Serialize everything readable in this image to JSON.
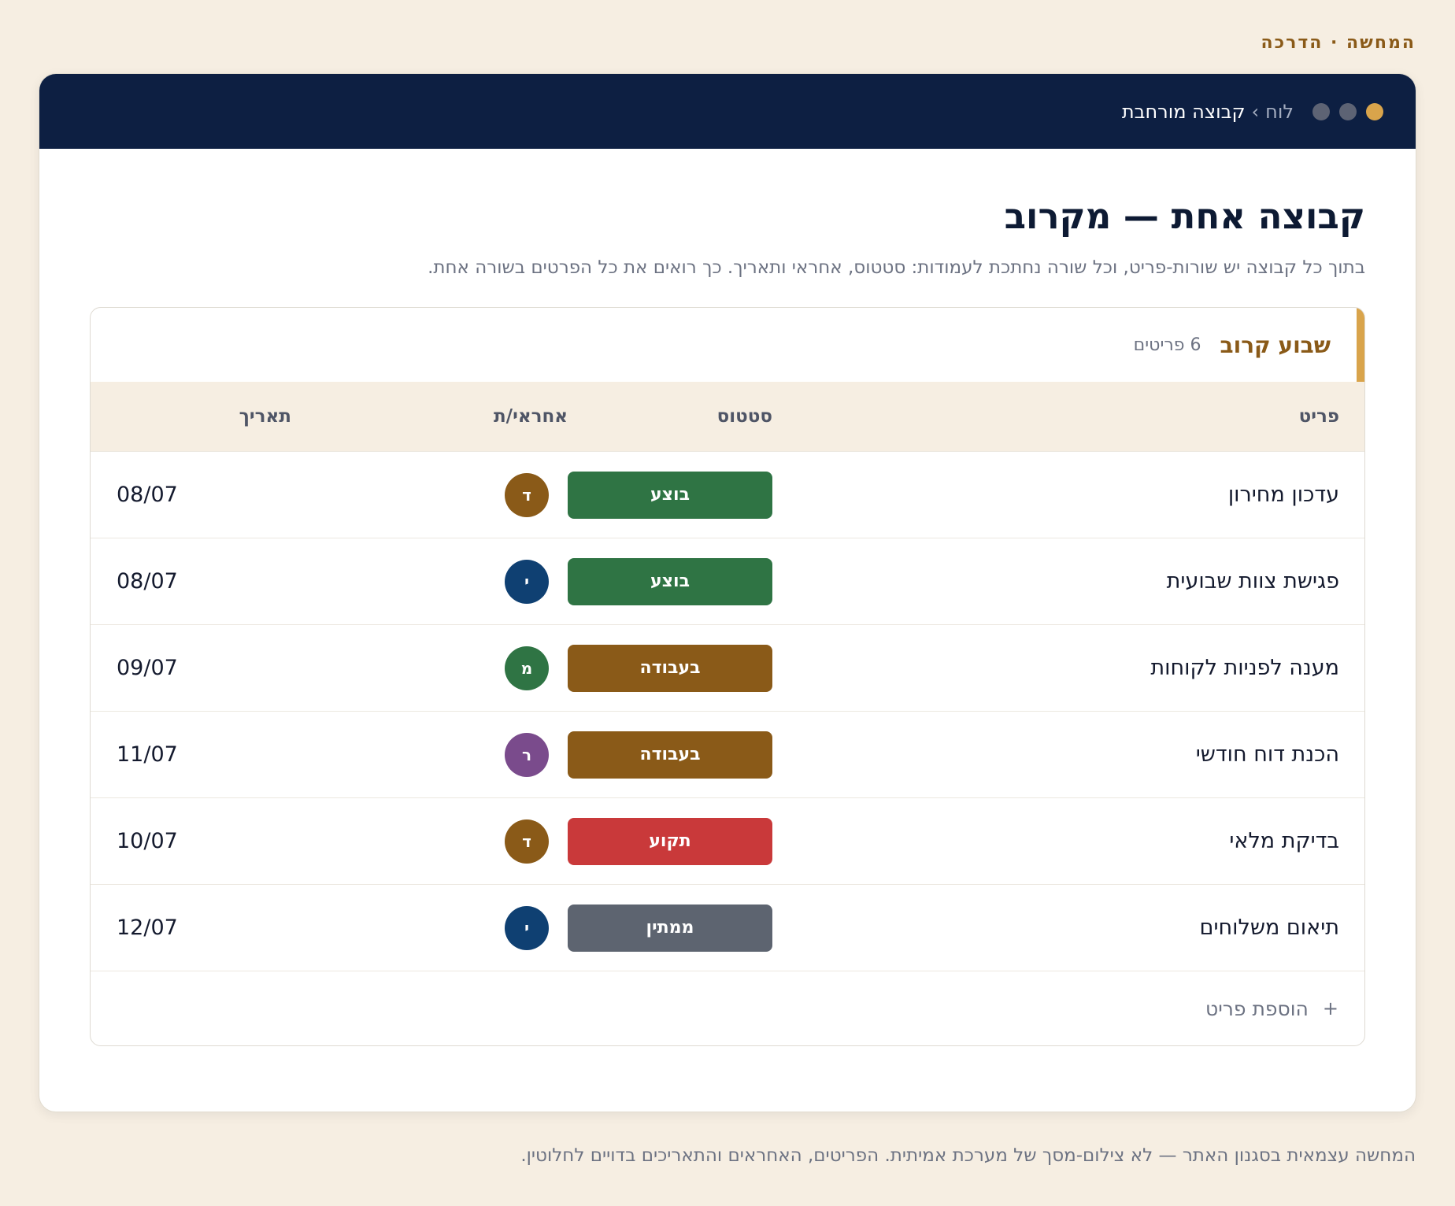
{
  "eyebrow": "המחשה · הדרכה",
  "window": {
    "breadcrumb": {
      "root": "לוח",
      "separator": "›",
      "current": "קבוצה מורחבת"
    }
  },
  "page": {
    "title": "קבוצה אחת — מקרוב",
    "description": "בתוך כל קבוצה יש שורות-פריט, וכל שורה נחתכת לעמודות: סטטוס, אחראי ותאריך. כך רואים את כל הפרטים בשורה אחת."
  },
  "group": {
    "name": "שבוע קרוב",
    "count": "6 פריטים",
    "accent_color": "#d9a44b",
    "columns": {
      "item": "פריט",
      "status": "סטטוס",
      "owner": "אחראי/ת",
      "date": "תאריך"
    },
    "rows": [
      {
        "item": "עדכון מחירון",
        "status": "בוצע",
        "status_color": "#2f7444",
        "owner": "ד",
        "owner_color": "#8a5a18",
        "date": "08/07"
      },
      {
        "item": "פגישת צוות שבועית",
        "status": "בוצע",
        "status_color": "#2f7444",
        "owner": "י",
        "owner_color": "#0f4072",
        "date": "08/07"
      },
      {
        "item": "מענה לפניות לקוחות",
        "status": "בעבודה",
        "status_color": "#8a5a18",
        "owner": "מ",
        "owner_color": "#2f7444",
        "date": "09/07"
      },
      {
        "item": "הכנת דוח חודשי",
        "status": "בעבודה",
        "status_color": "#8a5a18",
        "owner": "ר",
        "owner_color": "#7a4b8c",
        "date": "11/07"
      },
      {
        "item": "בדיקת מלאי",
        "status": "תקוע",
        "status_color": "#c9393a",
        "owner": "ד",
        "owner_color": "#8a5a18",
        "date": "10/07"
      },
      {
        "item": "תיאום משלוחים",
        "status": "ממתין",
        "status_color": "#5d6470",
        "owner": "י",
        "owner_color": "#0f4072",
        "date": "12/07"
      }
    ],
    "add_item": {
      "icon": "+",
      "label": "הוספת פריט"
    }
  },
  "footnote": "המחשה עצמאית בסגנון האתר — לא צילום-מסך של מערכת אמיתית. הפריטים, האחראים והתאריכים בדויים לחלוטין."
}
